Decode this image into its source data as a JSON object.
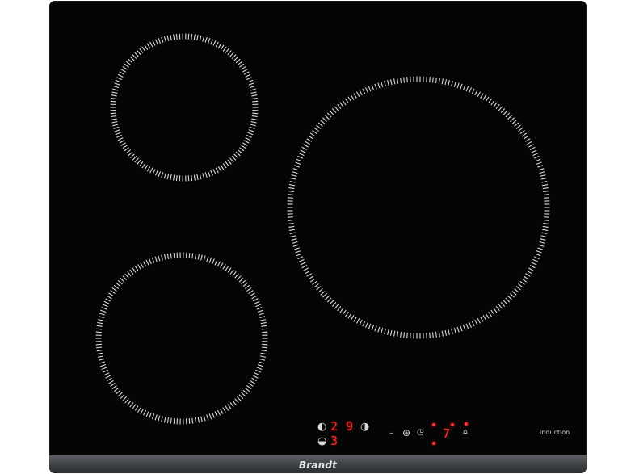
{
  "brand": "Brandt",
  "label_induction": "induction",
  "controls": {
    "zone_left_top_digit": "2",
    "zone_right_digit": "9",
    "zone_left_bottom_digit": "3",
    "timer_digit": "7",
    "minus_symbol": "–",
    "plus_symbol": "⊕"
  },
  "colors": {
    "glass": "#050505",
    "zone_ring": "#d9d9d9",
    "display": "#ff2b2b",
    "trim": "#4a4d50"
  }
}
